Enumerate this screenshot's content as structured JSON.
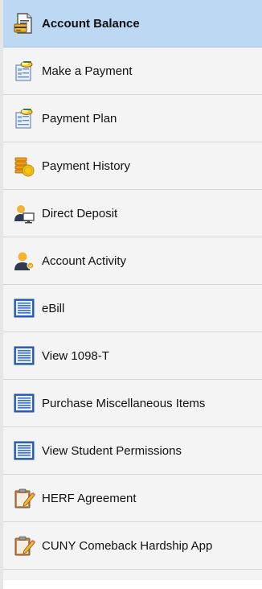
{
  "nav": {
    "items": [
      {
        "label": "Account Balance",
        "icon": "account-balance-icon",
        "active": true
      },
      {
        "label": "Make a Payment",
        "icon": "payment-form-icon"
      },
      {
        "label": "Payment Plan",
        "icon": "payment-form-icon"
      },
      {
        "label": "Payment History",
        "icon": "coins-history-icon"
      },
      {
        "label": "Direct Deposit",
        "icon": "person-monitor-icon"
      },
      {
        "label": "Account Activity",
        "icon": "person-activity-icon"
      },
      {
        "label": "eBill",
        "icon": "document-list-icon"
      },
      {
        "label": "View 1098-T",
        "icon": "document-list-icon"
      },
      {
        "label": "Purchase Miscellaneous Items",
        "icon": "document-list-icon"
      },
      {
        "label": "View Student Permissions",
        "icon": "document-list-icon"
      },
      {
        "label": "HERF Agreement",
        "icon": "clipboard-pencil-icon"
      },
      {
        "label": "CUNY Comeback Hardship App",
        "icon": "clipboard-pencil-icon"
      }
    ]
  }
}
